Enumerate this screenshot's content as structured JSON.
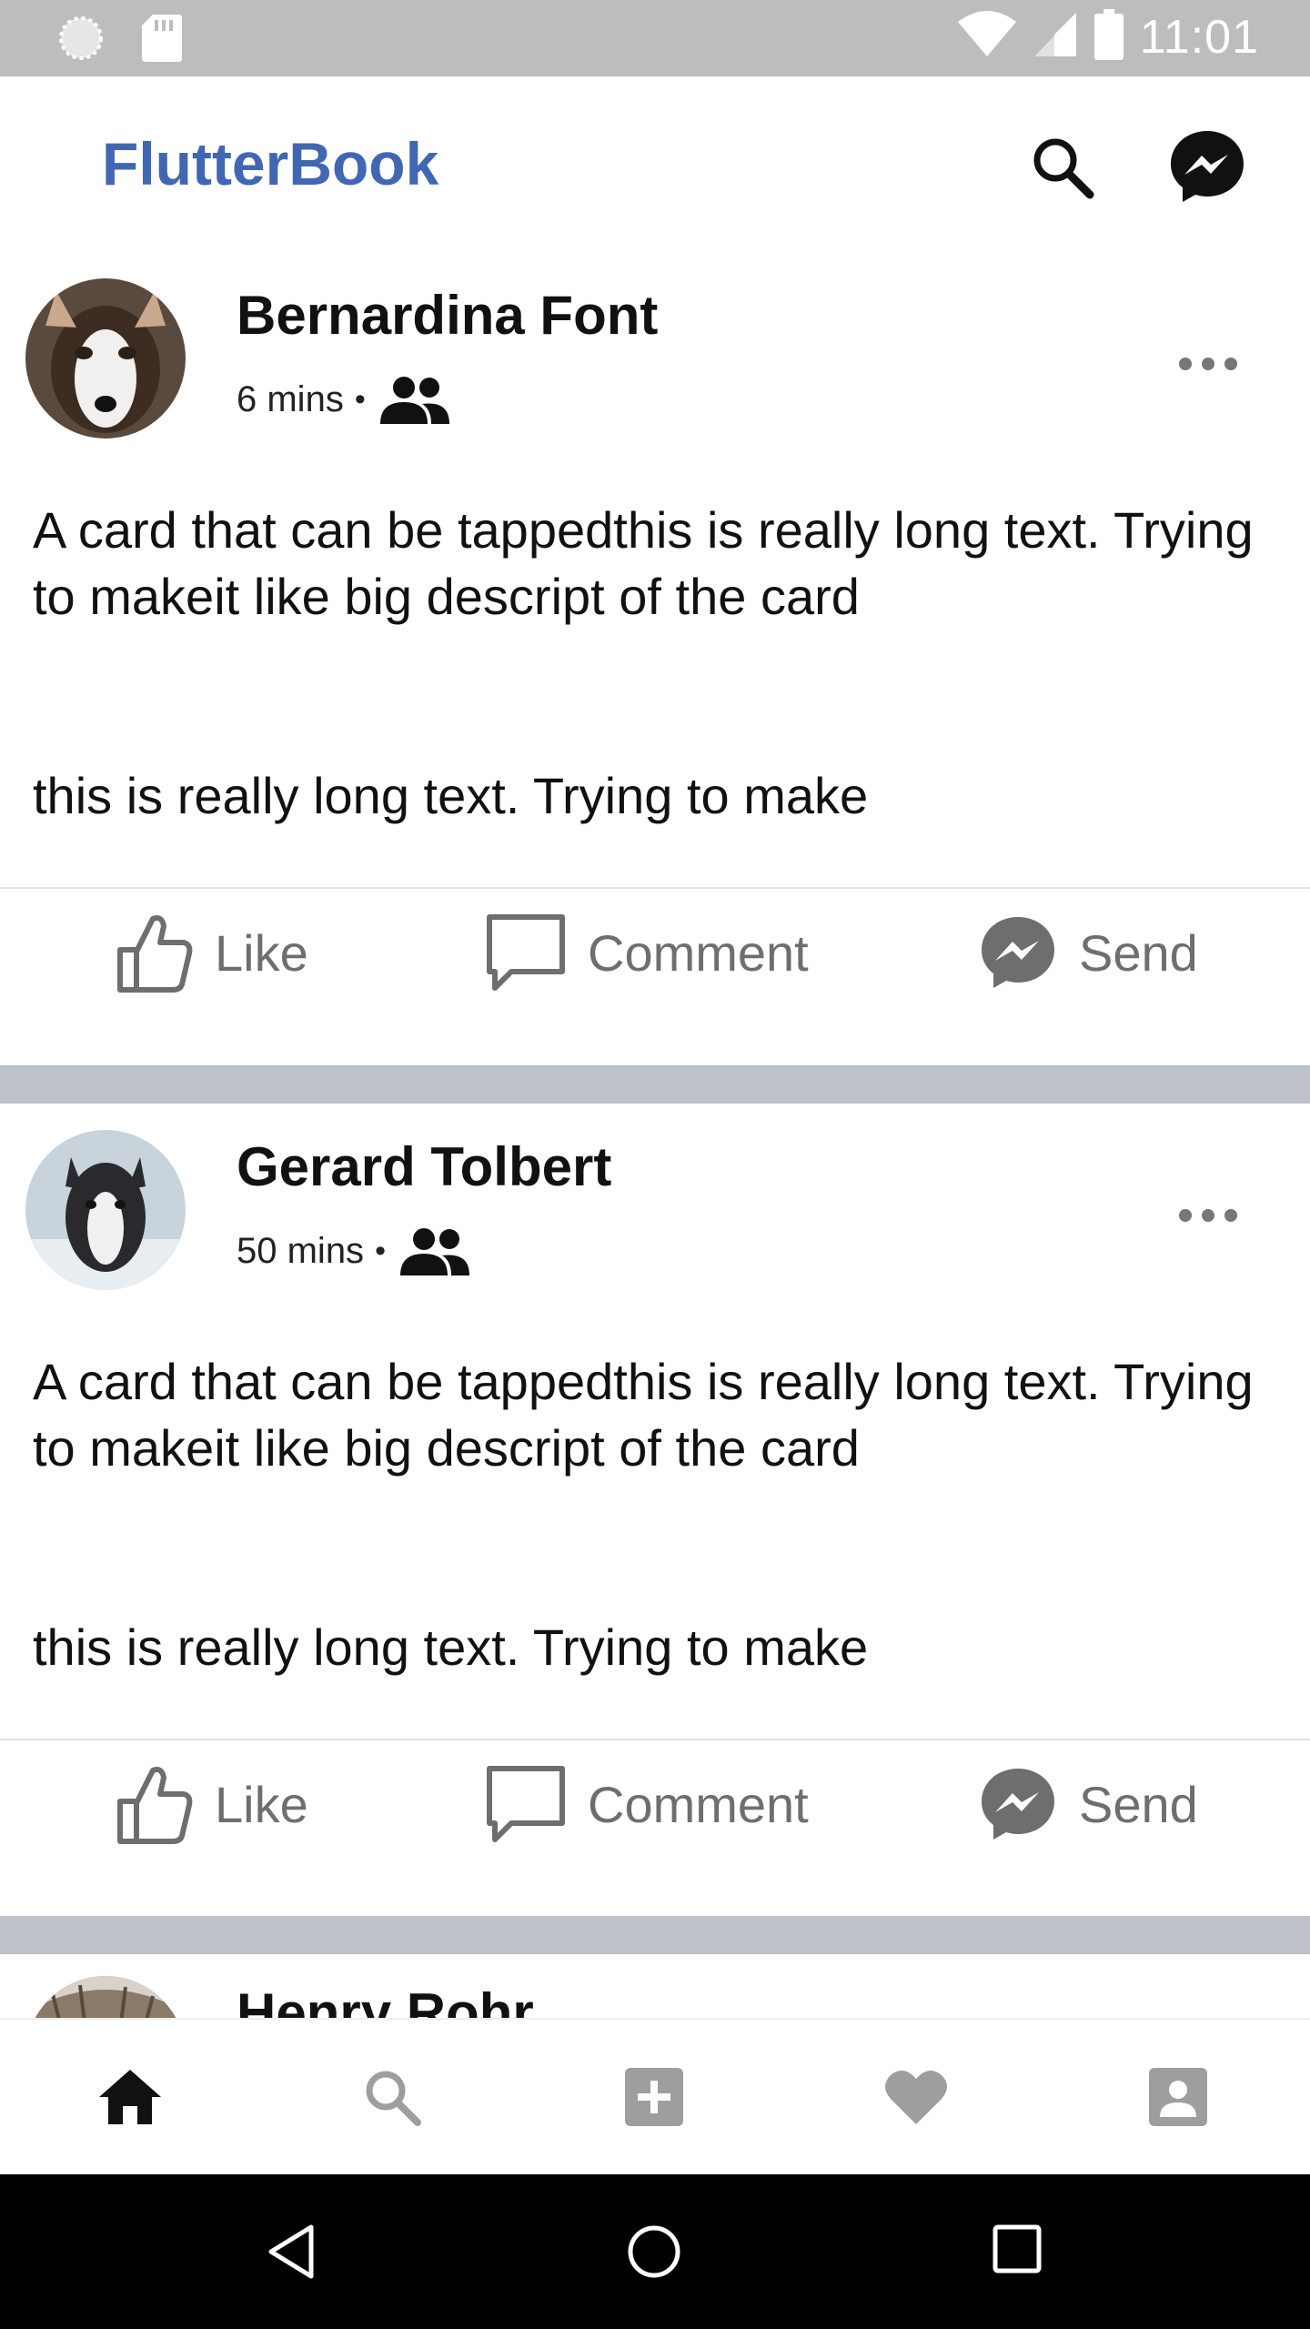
{
  "status_bar": {
    "time": "11:01"
  },
  "app_bar": {
    "title": "FlutterBook",
    "brand_color": "#4267b2"
  },
  "posts": [
    {
      "author": "Bernardina Font",
      "time": "6 mins",
      "separator_dot": "•",
      "text_para1": "A card that can be tappedthis is really long text. Trying to makeit like big descript of the card",
      "text_para2": "this is really long text. Trying to make"
    },
    {
      "author": "Gerard Tolbert",
      "time": "50 mins",
      "separator_dot": "•",
      "text_para1": "A card that can be tappedthis is really long text. Trying to makeit like big descript of the card",
      "text_para2": "this is really long text. Trying to make"
    },
    {
      "author": "Henry Rohr"
    }
  ],
  "actions": {
    "like": "Like",
    "comment": "Comment",
    "send": "Send"
  },
  "bottom_nav": {
    "items": [
      "home-icon",
      "search-icon",
      "add-box-icon",
      "favorite-icon",
      "account-box-icon"
    ],
    "active_color": "#111111",
    "inactive_color": "#9e9e9e"
  },
  "colors": {
    "separator": "#bcc1ca",
    "action_text": "#6e6e6e"
  }
}
